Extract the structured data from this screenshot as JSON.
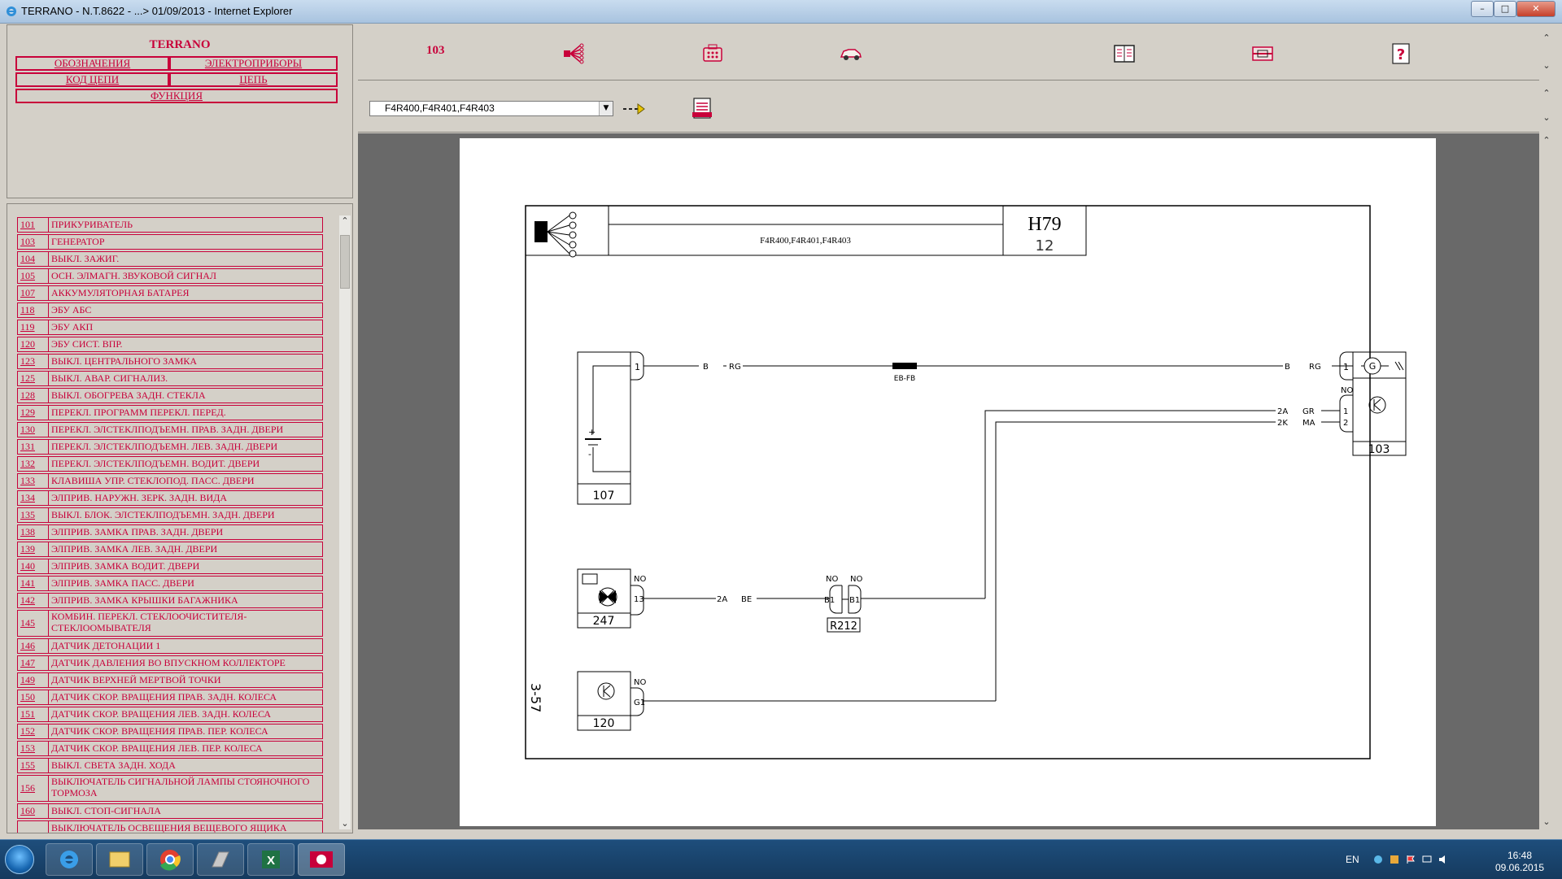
{
  "window": {
    "title": "TERRANO - N.T.8622 - ...> 01/09/2013 - Internet Explorer"
  },
  "nav": {
    "app_title": "TERRANO",
    "buttons": {
      "designations": "ОБОЗНАЧЕНИЯ",
      "devices": "ЭЛЕКТРОПРИБОРЫ",
      "circuit_code": "КОД ЦЕПИ",
      "circuit": "ЦЕПЬ",
      "function": "ФУНКЦИЯ"
    }
  },
  "components": [
    {
      "code": "101",
      "name": "ПРИКУРИВАТЕЛЬ"
    },
    {
      "code": "103",
      "name": "ГЕНЕРАТОР"
    },
    {
      "code": "104",
      "name": "ВЫКЛ. ЗАЖИГ."
    },
    {
      "code": "105",
      "name": "ОСН. ЭЛМАГН. ЗВУКОВОЙ СИГНАЛ"
    },
    {
      "code": "107",
      "name": "АККУМУЛЯТОРНАЯ БАТАРЕЯ"
    },
    {
      "code": "118",
      "name": "ЭБУ АБС"
    },
    {
      "code": "119",
      "name": "ЭБУ АКП"
    },
    {
      "code": "120",
      "name": "ЭБУ СИСТ. ВПР."
    },
    {
      "code": "123",
      "name": "ВЫКЛ. ЦЕНТРАЛЬНОГО ЗАМКА"
    },
    {
      "code": "125",
      "name": "ВЫКЛ. АВАР. СИГНАЛИЗ."
    },
    {
      "code": "128",
      "name": "ВЫКЛ. ОБОГРЕВА ЗАДН. СТЕКЛА"
    },
    {
      "code": "129",
      "name": "ПЕРЕКЛ. ПРОГРАММ ПЕРЕКЛ. ПЕРЕД."
    },
    {
      "code": "130",
      "name": "ПЕРЕКЛ. ЭЛСТЕКЛПОДЪЕМН. ПРАВ. ЗАДН. ДВЕРИ"
    },
    {
      "code": "131",
      "name": "ПЕРЕКЛ. ЭЛСТЕКЛПОДЪЕМН. ЛЕВ. ЗАДН. ДВЕРИ"
    },
    {
      "code": "132",
      "name": "ПЕРЕКЛ. ЭЛСТЕКЛПОДЪЕМН. ВОДИТ. ДВЕРИ"
    },
    {
      "code": "133",
      "name": "КЛАВИША УПР. СТЕКЛОПОД. ПАСС. ДВЕРИ"
    },
    {
      "code": "134",
      "name": "ЭЛПРИВ. НАРУЖН. ЗЕРК. ЗАДН. ВИДА"
    },
    {
      "code": "135",
      "name": "ВЫКЛ. БЛОК. ЭЛСТЕКЛПОДЪЕМН. ЗАДН. ДВЕРИ"
    },
    {
      "code": "138",
      "name": "ЭЛПРИВ. ЗАМКА ПРАВ. ЗАДН. ДВЕРИ"
    },
    {
      "code": "139",
      "name": "ЭЛПРИВ. ЗАМКА ЛЕВ. ЗАДН. ДВЕРИ"
    },
    {
      "code": "140",
      "name": "ЭЛПРИВ. ЗАМКА ВОДИТ. ДВЕРИ"
    },
    {
      "code": "141",
      "name": "ЭЛПРИВ. ЗАМКА ПАСС. ДВЕРИ"
    },
    {
      "code": "142",
      "name": "ЭЛПРИВ. ЗАМКА КРЫШКИ БАГАЖНИКА"
    },
    {
      "code": "145",
      "name": "КОМБИН. ПЕРЕКЛ. СТЕКЛООЧИСТИТЕЛЯ-СТЕКЛООМЫВАТЕЛЯ"
    },
    {
      "code": "146",
      "name": "ДАТЧИК ДЕТОНАЦИИ 1"
    },
    {
      "code": "147",
      "name": "ДАТЧИК ДАВЛЕНИЯ ВО ВПУСКНОМ КОЛЛЕКТОРЕ"
    },
    {
      "code": "149",
      "name": "ДАТЧИК ВЕРХНЕЙ МЕРТВОЙ ТОЧКИ"
    },
    {
      "code": "150",
      "name": "ДАТЧИК СКОР. ВРАЩЕНИЯ ПРАВ. ЗАДН. КОЛЕСА"
    },
    {
      "code": "151",
      "name": "ДАТЧИК СКОР. ВРАЩЕНИЯ ЛЕВ. ЗАДН. КОЛЕСА"
    },
    {
      "code": "152",
      "name": "ДАТЧИК СКОР. ВРАЩЕНИЯ ПРАВ. ПЕР. КОЛЕСА"
    },
    {
      "code": "153",
      "name": "ДАТЧИК СКОР. ВРАЩЕНИЯ ЛЕВ. ПЕР. КОЛЕСА"
    },
    {
      "code": "155",
      "name": "ВЫКЛ. СВЕТА ЗАДН. ХОДА"
    },
    {
      "code": "156",
      "name": "ВЫКЛЮЧАТЕЛЬ СИГНАЛЬНОЙ ЛАМПЫ СТОЯНОЧНОГО ТОРМОЗА"
    },
    {
      "code": "160",
      "name": "ВЫКЛ. СТОП-СИГНАЛА"
    },
    {
      "code": "",
      "name": "ВЫКЛЮЧАТЕЛЬ ОСВЕЩЕНИЯ ВЕЩЕВОГО ЯЩИКА"
    }
  ],
  "toolbar": {
    "circuit_code": "103",
    "engine_select_value": "F4R400,F4R401,F4R403"
  },
  "diagram": {
    "header_engine": "F4R400,F4R401,F4R403",
    "header_code": "H79",
    "header_sub": "12",
    "page_ref": "3-57",
    "components": {
      "battery": "107",
      "alternator": "103",
      "cluster": "247",
      "ecu": "120",
      "connector": "R212"
    },
    "wires": {
      "w1_left": "B",
      "w1_left2": "RG",
      "w1_right": "B",
      "w1_right2": "RG",
      "splice": "EB-FB",
      "w2a": "2A",
      "w2a_col": "GR",
      "w2k": "2K",
      "w2k_col": "MA",
      "w3": "2A",
      "w3_col": "BE"
    },
    "pins": {
      "batt_pin": "1",
      "alt_pin1": "1",
      "alt_no": "NO",
      "alt_p1": "1",
      "alt_p2": "2",
      "cl_no": "NO",
      "cl_pin": "13",
      "r_no1": "NO",
      "r_no2": "NO",
      "r_b1a": "B1",
      "r_b1b": "B1",
      "ecu_no": "NO",
      "ecu_pin": "G1",
      "plus": "+",
      "minus": "-",
      "gen_g": "G"
    }
  },
  "taskbar": {
    "lang": "EN",
    "time": "16:48",
    "date": "09.06.2015"
  }
}
